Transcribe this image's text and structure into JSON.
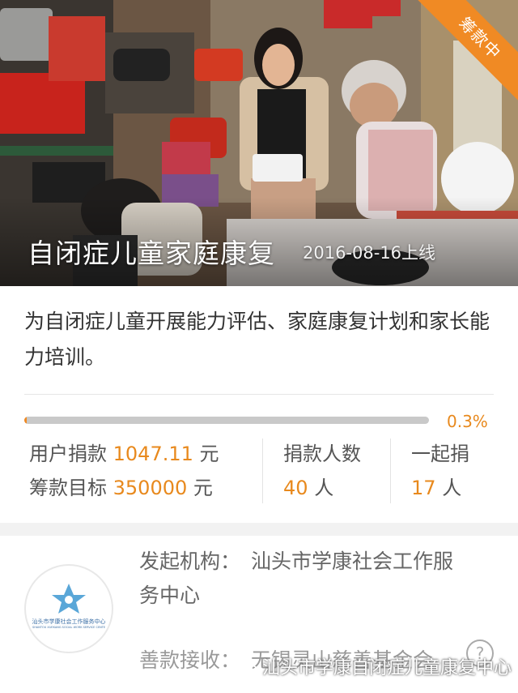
{
  "hero": {
    "title": "自闭症儿童家庭康复",
    "date": "2016-08-16上线",
    "status_ribbon": "筹款中"
  },
  "project": {
    "description": "为自闭症儿童开展能力评估、家庭康复计划和家长能力培训。",
    "progress_percent_label": "0.3%",
    "progress_fraction": 0.003
  },
  "stats": {
    "user_donation_label": "用户捐款",
    "user_donation_value": "1047.11",
    "user_donation_unit": "元",
    "goal_label": "筹款目标",
    "goal_value": "350000",
    "goal_unit": "元",
    "donors_label": "捐款人数",
    "donors_value": "40",
    "donors_unit": "人",
    "together_label": "一起捐",
    "together_value": "17",
    "together_unit": "人"
  },
  "organization": {
    "initiator_label": "发起机构：",
    "initiator_name_line1": "汕头市学康社会工作服",
    "initiator_name_line2": "务中心",
    "logo_text_cn": "汕头市学康社会工作服务中心",
    "logo_text_en": "SHANTOU XUEKANG SOCIAL WORK SERVICE CENTER",
    "receiver_label": "善款接收：",
    "receiver_name": "无锡灵山慈善基金会",
    "help_symbol": "?"
  },
  "watermark": {
    "text": "汕头市学康自闭症儿童康复中心"
  },
  "colors": {
    "accent": "#f08a24",
    "accent_text": "#e8891d",
    "track": "#c9c9c9"
  }
}
